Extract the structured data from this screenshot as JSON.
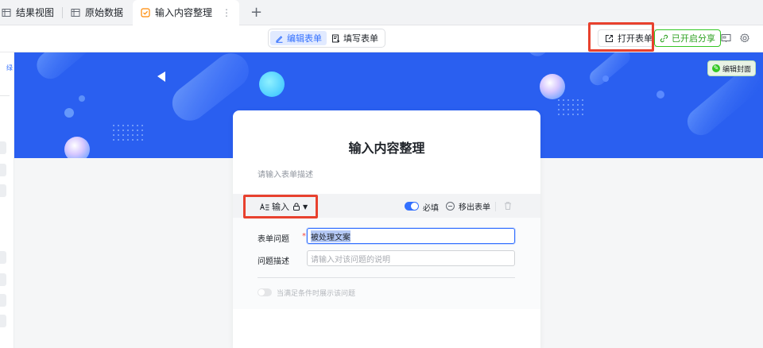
{
  "tabs": [
    {
      "label": "结果视图",
      "icon": "grid-table-icon"
    },
    {
      "label": "原始数据",
      "icon": "grid-table-icon"
    },
    {
      "label": "输入内容整理",
      "icon": "form-checkbox-icon",
      "active": true
    }
  ],
  "tab_more": "⋮",
  "tab_add": "+",
  "toolbar": {
    "edit_mode": "编辑表单",
    "fill_mode": "填写表单",
    "open_form": "打开表单",
    "share": "已开启分享"
  },
  "left_strip": {
    "fragment": "绿"
  },
  "banner": {
    "edit_cover": "编辑封面"
  },
  "form": {
    "title": "输入内容整理",
    "description_placeholder": "请输入表单描述",
    "question": {
      "type_label": "输入",
      "required_label": "必填",
      "remove_label": "移出表单",
      "title_label": "表单问题",
      "required_star": "*",
      "title_value": "被处理文案",
      "desc_label": "问题描述",
      "desc_placeholder": "请输入对该问题的说明",
      "condition_label": "当满足条件时展示该问题"
    }
  },
  "colors": {
    "accent": "#3370ff",
    "banner": "#2a5ff0",
    "highlight": "#e8412e",
    "share_green": "#34c724"
  }
}
